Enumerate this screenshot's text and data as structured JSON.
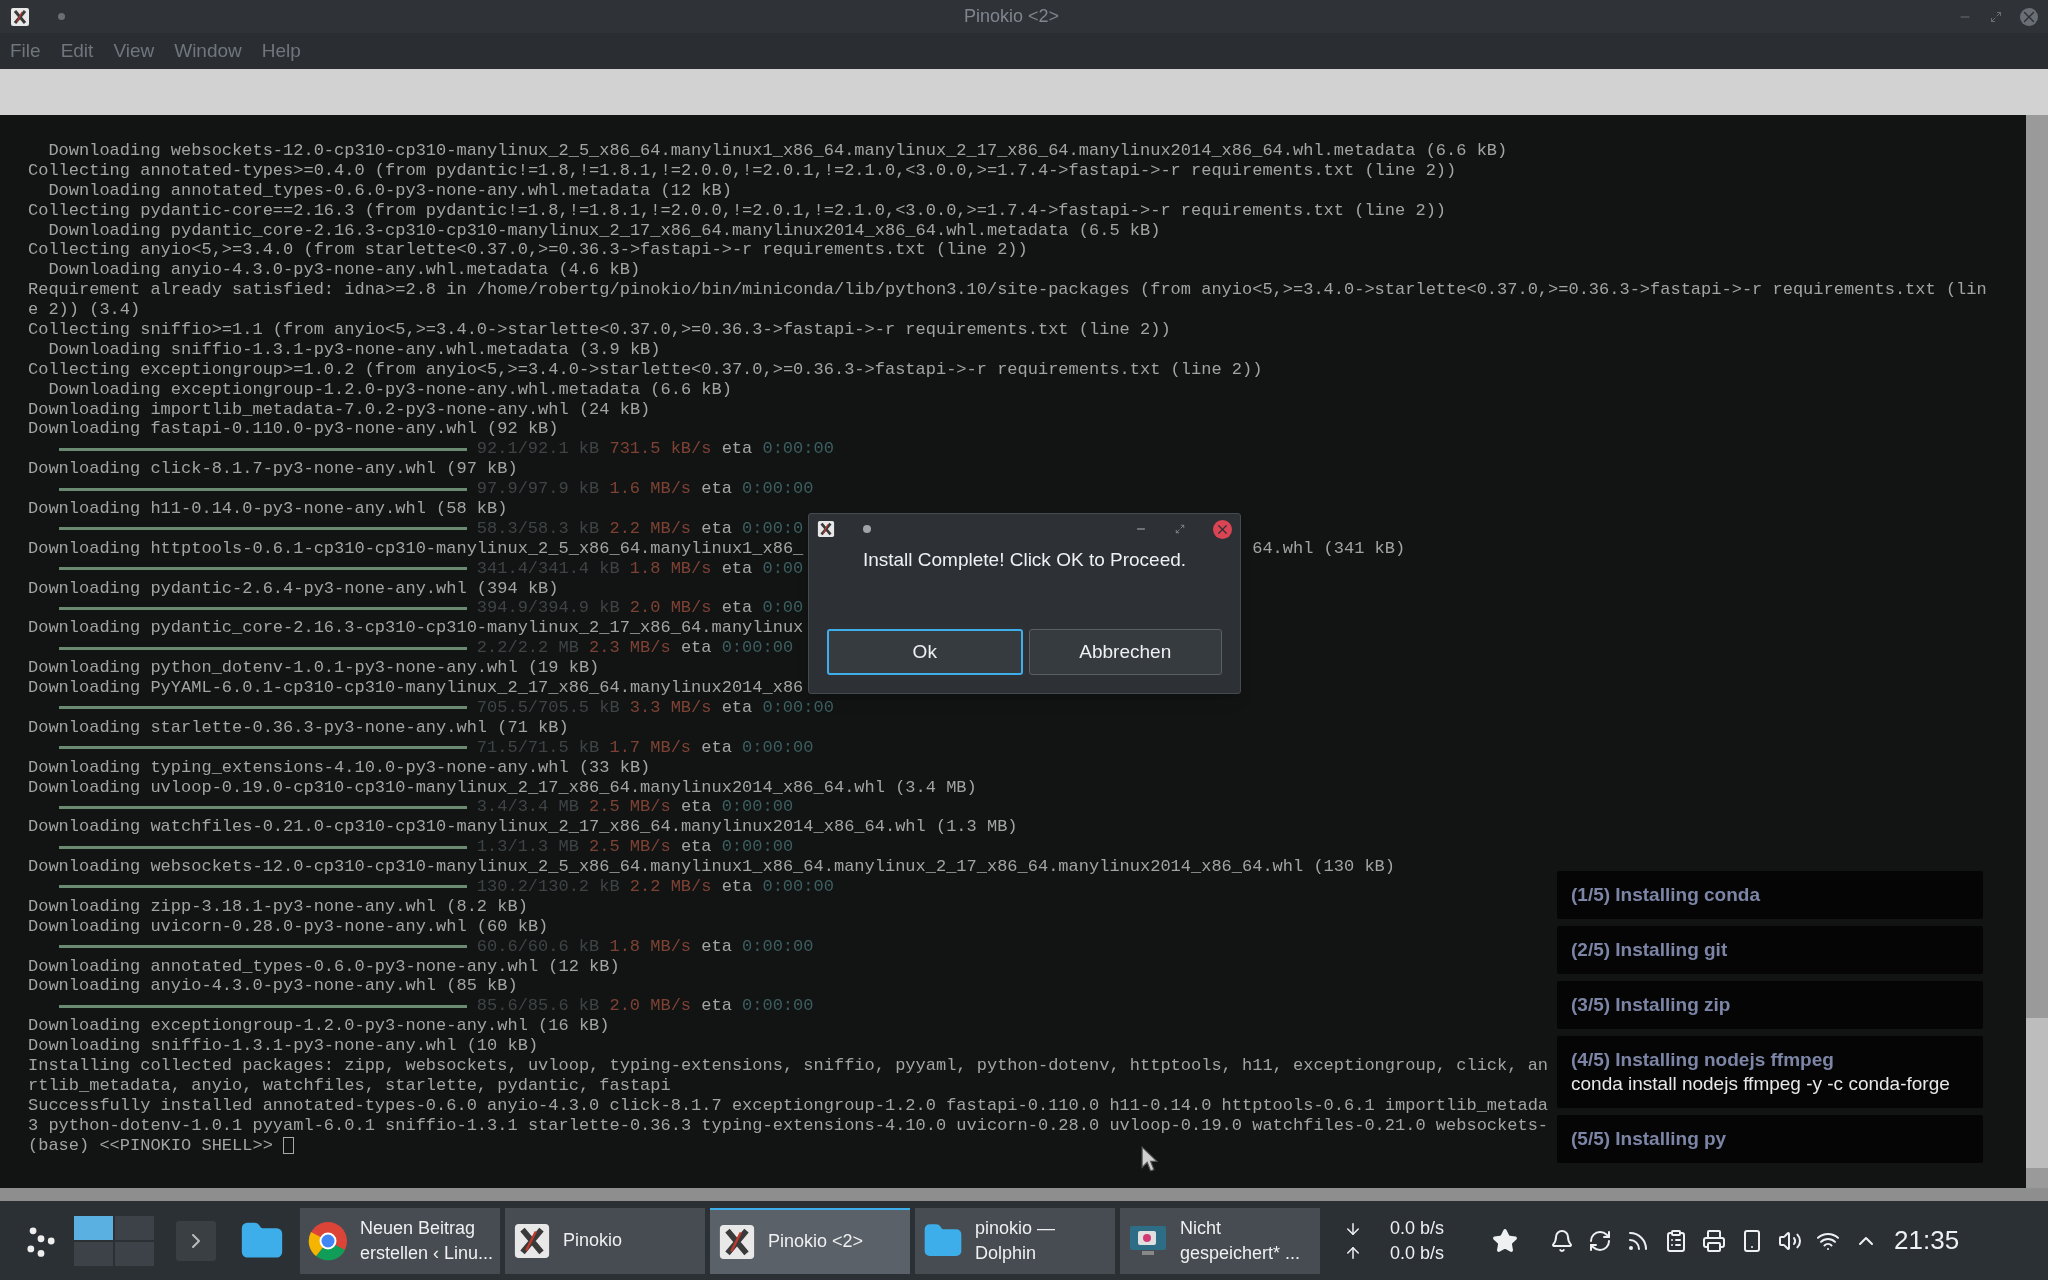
{
  "window": {
    "title": "Pinokio <2>"
  },
  "menu": [
    "File",
    "Edit",
    "View",
    "Window",
    "Help"
  ],
  "terminal": {
    "lines": [
      {
        "kind": "text",
        "text": "  Downloading websockets-12.0-cp310-cp310-manylinux_2_5_x86_64.manylinux1_x86_64.manylinux_2_17_x86_64.manylinux2014_x86_64.whl.metadata (6.6 kB)"
      },
      {
        "kind": "text",
        "text": "Collecting annotated-types>=0.4.0 (from pydantic!=1.8,!=1.8.1,!=2.0.0,!=2.0.1,!=2.1.0,<3.0.0,>=1.7.4->fastapi->-r requirements.txt (line 2))"
      },
      {
        "kind": "text",
        "text": "  Downloading annotated_types-0.6.0-py3-none-any.whl.metadata (12 kB)"
      },
      {
        "kind": "text",
        "text": "Collecting pydantic-core==2.16.3 (from pydantic!=1.8,!=1.8.1,!=2.0.0,!=2.0.1,!=2.1.0,<3.0.0,>=1.7.4->fastapi->-r requirements.txt (line 2))"
      },
      {
        "kind": "text",
        "text": "  Downloading pydantic_core-2.16.3-cp310-cp310-manylinux_2_17_x86_64.manylinux2014_x86_64.whl.metadata (6.5 kB)"
      },
      {
        "kind": "text",
        "text": "Collecting anyio<5,>=3.4.0 (from starlette<0.37.0,>=0.36.3->fastapi->-r requirements.txt (line 2))"
      },
      {
        "kind": "text",
        "text": "  Downloading anyio-4.3.0-py3-none-any.whl.metadata (4.6 kB)"
      },
      {
        "kind": "text",
        "text": "Requirement already satisfied: idna>=2.8 in /home/robertg/pinokio/bin/miniconda/lib/python3.10/site-packages (from anyio<5,>=3.4.0->starlette<0.37.0,>=0.36.3->fastapi->-r requirements.txt (lin"
      },
      {
        "kind": "text",
        "text": "e 2)) (3.4)"
      },
      {
        "kind": "text",
        "text": "Collecting sniffio>=1.1 (from anyio<5,>=3.4.0->starlette<0.37.0,>=0.36.3->fastapi->-r requirements.txt (line 2))"
      },
      {
        "kind": "text",
        "text": "  Downloading sniffio-1.3.1-py3-none-any.whl.metadata (3.9 kB)"
      },
      {
        "kind": "text",
        "text": "Collecting exceptiongroup>=1.0.2 (from anyio<5,>=3.4.0->starlette<0.37.0,>=0.36.3->fastapi->-r requirements.txt (line 2))"
      },
      {
        "kind": "text",
        "text": "  Downloading exceptiongroup-1.2.0-py3-none-any.whl.metadata (6.6 kB)"
      },
      {
        "kind": "text",
        "text": "Downloading importlib_metadata-7.0.2-py3-none-any.whl (24 kB)"
      },
      {
        "kind": "text",
        "text": "Downloading fastapi-0.110.0-py3-none-any.whl (92 kB)"
      },
      {
        "kind": "progress",
        "level": 1,
        "size": "92.1/92.1 kB",
        "speed": "731.5 kB/s",
        "eta_label": "eta",
        "eta": "0:00:00"
      },
      {
        "kind": "text",
        "text": "Downloading click-8.1.7-py3-none-any.whl (97 kB)"
      },
      {
        "kind": "progress",
        "level": 1,
        "size": "97.9/97.9 kB",
        "speed": "1.6 MB/s",
        "eta_label": "eta",
        "eta": "0:00:00"
      },
      {
        "kind": "text",
        "text": "Downloading h11-0.14.0-py3-none-any.whl (58 kB)"
      },
      {
        "kind": "progress",
        "level": 1,
        "size": "58.3/58.3 kB",
        "speed": "2.2 MB/s",
        "eta_label": "eta",
        "eta": "0:00:0"
      },
      {
        "kind": "text",
        "text": "Downloading httptools-0.6.1-cp310-cp310-manylinux_2_5_x86_64.manylinux1_x86_",
        "right": "64.whl (341 kB)"
      },
      {
        "kind": "progress",
        "level": 1,
        "size": "341.4/341.4 kB",
        "speed": "1.8 MB/s",
        "eta_label": "eta",
        "eta": "0:00"
      },
      {
        "kind": "text",
        "text": "Downloading pydantic-2.6.4-py3-none-any.whl (394 kB)"
      },
      {
        "kind": "progress",
        "level": 1,
        "size": "394.9/394.9 kB",
        "speed": "2.0 MB/s",
        "eta_label": "eta",
        "eta": "0:00"
      },
      {
        "kind": "text",
        "text": "Downloading pydantic_core-2.16.3-cp310-cp310-manylinux_2_17_x86_64.manylinux"
      },
      {
        "kind": "progress",
        "level": 1,
        "size": "2.2/2.2 MB",
        "speed": "2.3 MB/s",
        "eta_label": "eta",
        "eta": "0:00:00"
      },
      {
        "kind": "text",
        "text": "Downloading python_dotenv-1.0.1-py3-none-any.whl (19 kB)"
      },
      {
        "kind": "text",
        "text": "Downloading PyYAML-6.0.1-cp310-cp310-manylinux_2_17_x86_64.manylinux2014_x86"
      },
      {
        "kind": "progress",
        "level": 1,
        "size": "705.5/705.5 kB",
        "speed": "3.3 MB/s",
        "eta_label": "eta",
        "eta": "0:00:00"
      },
      {
        "kind": "text",
        "text": "Downloading starlette-0.36.3-py3-none-any.whl (71 kB)"
      },
      {
        "kind": "progress",
        "level": 1,
        "size": "71.5/71.5 kB",
        "speed": "1.7 MB/s",
        "eta_label": "eta",
        "eta": "0:00:00"
      },
      {
        "kind": "text",
        "text": "Downloading typing_extensions-4.10.0-py3-none-any.whl (33 kB)"
      },
      {
        "kind": "text",
        "text": "Downloading uvloop-0.19.0-cp310-cp310-manylinux_2_17_x86_64.manylinux2014_x86_64.whl (3.4 MB)"
      },
      {
        "kind": "progress",
        "level": 1,
        "size": "3.4/3.4 MB",
        "speed": "2.5 MB/s",
        "eta_label": "eta",
        "eta": "0:00:00"
      },
      {
        "kind": "text",
        "text": "Downloading watchfiles-0.21.0-cp310-cp310-manylinux_2_17_x86_64.manylinux2014_x86_64.whl (1.3 MB)"
      },
      {
        "kind": "progress",
        "level": 1,
        "size": "1.3/1.3 MB",
        "speed": "2.5 MB/s",
        "eta_label": "eta",
        "eta": "0:00:00"
      },
      {
        "kind": "text",
        "text": "Downloading websockets-12.0-cp310-cp310-manylinux_2_5_x86_64.manylinux1_x86_64.manylinux_2_17_x86_64.manylinux2014_x86_64.whl (130 kB)"
      },
      {
        "kind": "progress",
        "level": 1,
        "size": "130.2/130.2 kB",
        "speed": "2.2 MB/s",
        "eta_label": "eta",
        "eta": "0:00:00"
      },
      {
        "kind": "text",
        "text": "Downloading zipp-3.18.1-py3-none-any.whl (8.2 kB)"
      },
      {
        "kind": "text",
        "text": "Downloading uvicorn-0.28.0-py3-none-any.whl (60 kB)"
      },
      {
        "kind": "progress",
        "level": 1,
        "size": "60.6/60.6 kB",
        "speed": "1.8 MB/s",
        "eta_label": "eta",
        "eta": "0:00:00"
      },
      {
        "kind": "text",
        "text": "Downloading annotated_types-0.6.0-py3-none-any.whl (12 kB)"
      },
      {
        "kind": "text",
        "text": "Downloading anyio-4.3.0-py3-none-any.whl (85 kB)"
      },
      {
        "kind": "progress",
        "level": 1,
        "size": "85.6/85.6 kB",
        "speed": "2.0 MB/s",
        "eta_label": "eta",
        "eta": "0:00:00"
      },
      {
        "kind": "text",
        "text": "Downloading exceptiongroup-1.2.0-py3-none-any.whl (16 kB)"
      },
      {
        "kind": "text",
        "text": "Downloading sniffio-1.3.1-py3-none-any.whl (10 kB)"
      },
      {
        "kind": "text",
        "text": "Installing collected packages: zipp, websockets, uvloop, typing-extensions, sniffio, pyyaml, python-dotenv, httptools, h11, exceptiongroup, click, an"
      },
      {
        "kind": "text",
        "text": "rtlib_metadata, anyio, watchfiles, starlette, pydantic, fastapi"
      },
      {
        "kind": "text",
        "text": "Successfully installed annotated-types-0.6.0 anyio-4.3.0 click-8.1.7 exceptiongroup-1.2.0 fastapi-0.110.0 h11-0.14.0 httptools-0.6.1 importlib_metada"
      },
      {
        "kind": "text",
        "text": "3 python-dotenv-1.0.1 pyyaml-6.0.1 sniffio-1.3.1 starlette-0.36.3 typing-extensions-4.10.0 uvicorn-0.28.0 uvloop-0.19.0 watchfiles-0.21.0 websockets-"
      },
      {
        "kind": "prompt",
        "text": "(base) <<PINOKIO SHELL>>"
      }
    ]
  },
  "dialog": {
    "message": "Install Complete! Click OK to Proceed.",
    "buttons": [
      {
        "label": "Ok",
        "focused": true
      },
      {
        "label": "Abbrechen",
        "focused": false
      }
    ]
  },
  "steps": [
    {
      "title": "(1/5) Installing conda"
    },
    {
      "title": "(2/5) Installing git"
    },
    {
      "title": "(3/5) Installing zip"
    },
    {
      "title": "(4/5) Installing nodejs ffmpeg",
      "detail": "conda install nodejs ffmpeg -y -c conda-forge"
    },
    {
      "title": "(5/5) Installing py"
    }
  ],
  "taskbar": {
    "tasks": [
      {
        "kind": "browser",
        "label": [
          "Neuen Beitrag",
          "erstellen ‹ Linu..."
        ],
        "selected": false
      },
      {
        "kind": "app",
        "label": [
          "Pinokio"
        ],
        "selected": false
      },
      {
        "kind": "app",
        "label": [
          "Pinokio <2>"
        ],
        "selected": true
      },
      {
        "kind": "folder",
        "label": [
          "pinokio —",
          "Dolphin"
        ],
        "selected": false
      },
      {
        "kind": "screenshot",
        "label": [
          "Nicht",
          "gespeichert* ..."
        ],
        "selected": false
      }
    ],
    "download_speed": "0.0 b/s",
    "upload_speed": "0.0 b/s",
    "clock": "21:35"
  }
}
